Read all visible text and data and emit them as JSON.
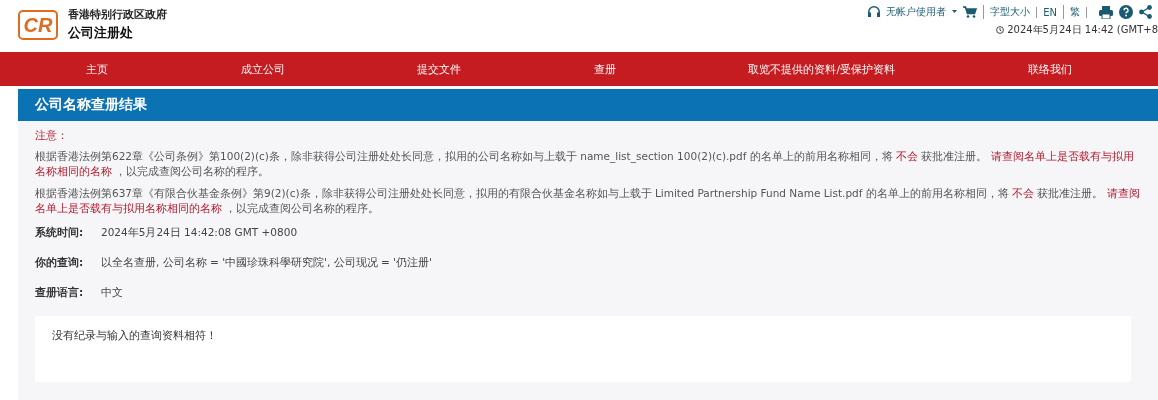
{
  "header": {
    "logo": "CR",
    "org_line": "香港特别行政区政府",
    "org_name": "公司注册处",
    "user": "无帐户使用者",
    "links": [
      "字型大小",
      "EN",
      "繁"
    ],
    "datetime": "2024年5月24日 14:42 (GMT+8"
  },
  "nav": [
    "主页",
    "成立公司",
    "提交文件",
    "查册",
    "取览不提供的资料/受保护资料",
    "联络我们"
  ],
  "panel": {
    "title": "公司名称查册结果",
    "notice_label": "注意：",
    "notices": [
      [
        {
          "text": "根据香港法例第622章《公司条例》第100(2)(c)条，除非获得公司注册处处长同意，拟用的公司名称如与上载于 name_list_section 100(2)(c).pdf 的名单上的前用名称相同，将 ",
          "red": false
        },
        {
          "text": "不会",
          "red": true
        },
        {
          "text": " 获批准注册。 ",
          "red": false
        },
        {
          "text": "请查阅名单上是否载有与拟用名称相同的名称",
          "red": true
        },
        {
          "text": " ，以完成查阅公司名称的程序。",
          "red": false
        }
      ],
      [
        {
          "text": "根据香港法例第637章《有限合伙基金条例》第9(2)(c)条，除非获得公司注册处处长同意，拟用的有限合伙基金名称如与上载于 Limited Partnership Fund Name List.pdf 的名单上的前用名称相同，将 ",
          "red": false
        },
        {
          "text": "不会",
          "red": true
        },
        {
          "text": " 获批准注册。 ",
          "red": false
        },
        {
          "text": "请查阅名单上是否载有与拟用名称相同的名称",
          "red": true
        },
        {
          "text": " ，以完成查阅公司名称的程序。",
          "red": false
        }
      ]
    ],
    "fields": [
      {
        "label": "系统时间:",
        "value": "2024年5月24日 14:42:08 GMT +0800"
      },
      {
        "label": "你的查询:",
        "value": "以全名查册, 公司名称 = '中國珍珠科學研究院', 公司现况 = '仍注册'"
      },
      {
        "label": "查册语言:",
        "value": "中文"
      }
    ],
    "result": "没有纪录与输入的查询资料相符！"
  }
}
